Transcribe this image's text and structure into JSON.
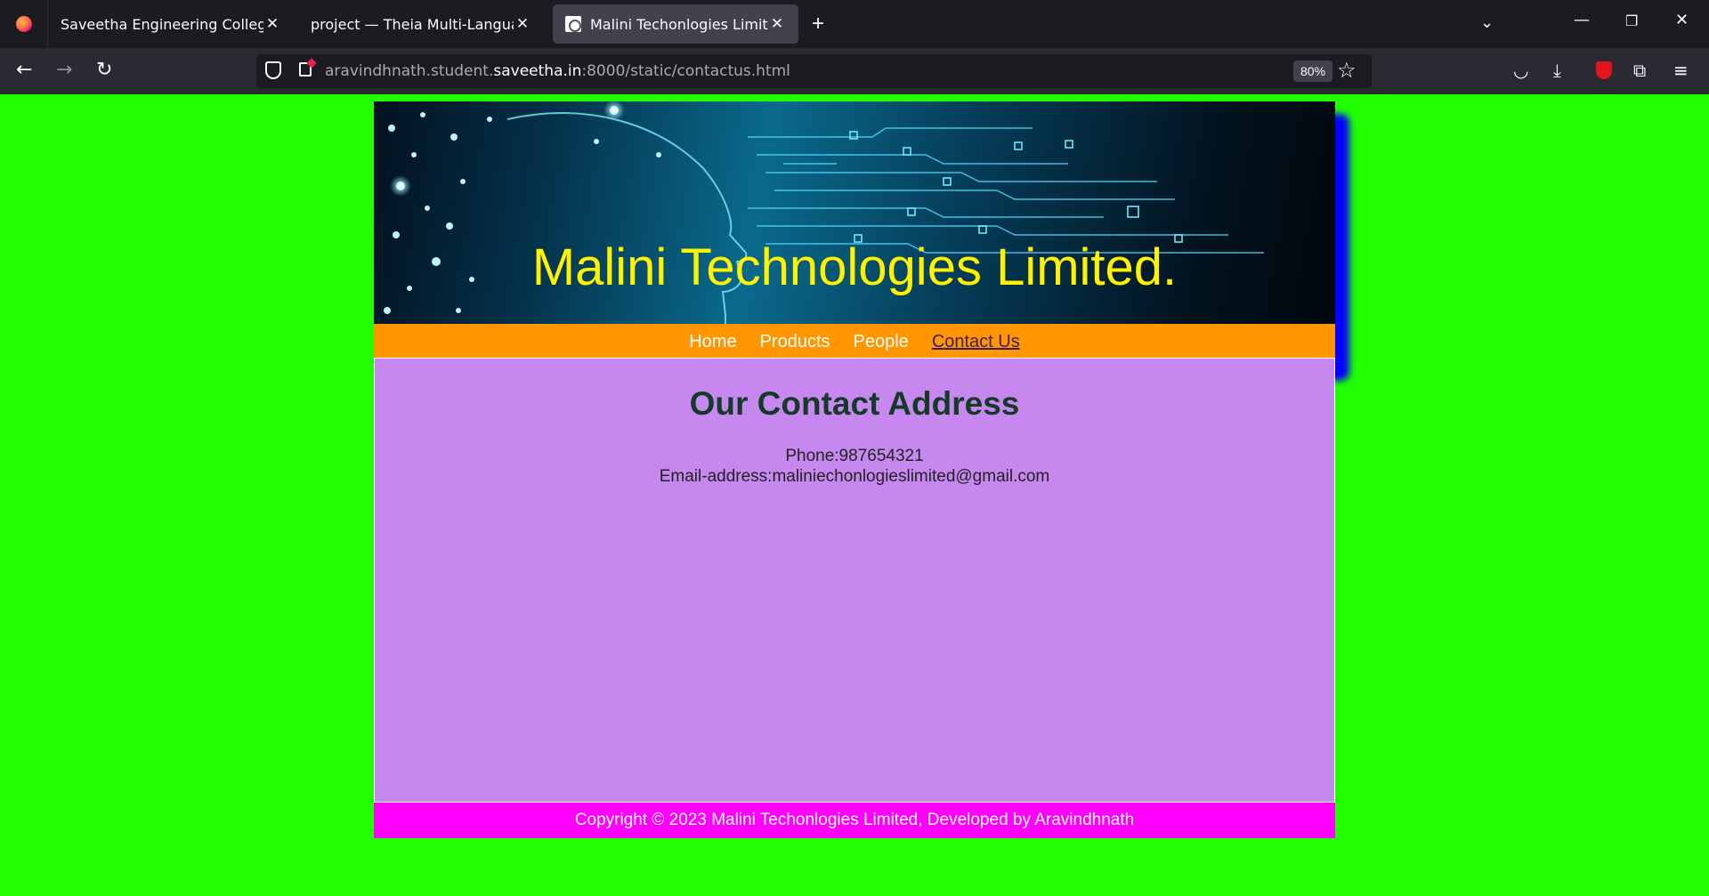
{
  "browser": {
    "tabs": [
      {
        "title": "Saveetha Engineering College"
      },
      {
        "title": "project — Theia Multi-Language Ex"
      },
      {
        "title": "Malini Techonlogies Limited"
      }
    ],
    "url": {
      "prefix": "aravindhnath.student.",
      "host": "saveetha.in",
      "suffix": ":8000/static/contactus.html"
    },
    "zoom": "80%",
    "icons": {
      "back": "back-arrow-icon",
      "forward": "forward-arrow-icon",
      "reload": "reload-icon",
      "pocket": "pocket-icon",
      "download": "download-icon",
      "extensions": "puzzle-icon",
      "menu": "hamburger-icon"
    }
  },
  "site": {
    "banner_title": "Malini Technologies Limited.",
    "menu": [
      "Home",
      "Products",
      "People",
      "Contact Us"
    ],
    "heading": "Our Contact Address",
    "phone": "Phone:987654321",
    "email": "Email-address:maliniechonlogieslimited@gmail.com",
    "footer": "Copyright © 2023 Malini Techonlogies Limited, Developed by Aravindhnath",
    "colors": {
      "background": "#22ff00",
      "title": "#fff200",
      "menu_bar": "#ff9500",
      "content": "#c687ee",
      "footer": "#ff00ff",
      "shadow": "#0400ff"
    }
  }
}
